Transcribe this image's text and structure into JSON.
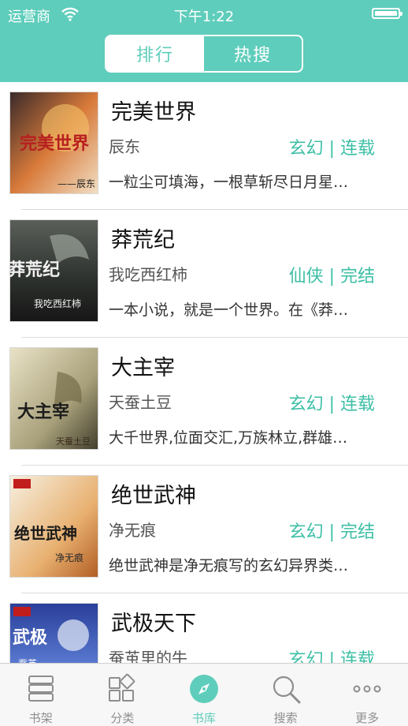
{
  "status_bar": {
    "carrier": "运营商",
    "time": "下午1:22"
  },
  "segment": {
    "tabs": [
      "排行",
      "热搜"
    ]
  },
  "books": [
    {
      "title": "完美世界",
      "author": "辰东",
      "genre": "玄幻 | 连载",
      "desc": "一粒尘可填海，一根草斩尽日月星…",
      "cover_text": "完美世界",
      "cover_sub": "——辰东"
    },
    {
      "title": "莽荒纪",
      "author": "我吃西红柿",
      "genre": "仙侠 | 完结",
      "desc": "一本小说，就是一个世界。在《莽…",
      "cover_text": "莽荒纪",
      "cover_sub": "我吃西红柿"
    },
    {
      "title": "大主宰",
      "author": "天蚕土豆",
      "genre": "玄幻 | 连载",
      "desc": "大千世界,位面交汇,万族林立,群雄…",
      "cover_text": "大主宰",
      "cover_sub": "天蚕土豆"
    },
    {
      "title": "绝世武神",
      "author": "净无痕",
      "genre": "玄幻 | 完结",
      "desc": "绝世武神是净无痕写的玄幻异界类…",
      "cover_text": "绝世武神",
      "cover_sub": "净无痕"
    },
    {
      "title": "武极天下",
      "author": "蚕茧里的牛",
      "genre": "玄幻 | 连载",
      "desc": "",
      "cover_text": "武极",
      "cover_sub": "蚕茧"
    }
  ],
  "tab_bar": [
    {
      "label": "书架",
      "icon": "bookshelf-icon"
    },
    {
      "label": "分类",
      "icon": "category-icon"
    },
    {
      "label": "书库",
      "icon": "compass-icon"
    },
    {
      "label": "搜索",
      "icon": "search-icon"
    },
    {
      "label": "更多",
      "icon": "more-icon"
    }
  ],
  "colors": {
    "accent": "#5fcdbb",
    "genre": "#3dbfa6",
    "tab_inactive": "#8e8e8e"
  }
}
